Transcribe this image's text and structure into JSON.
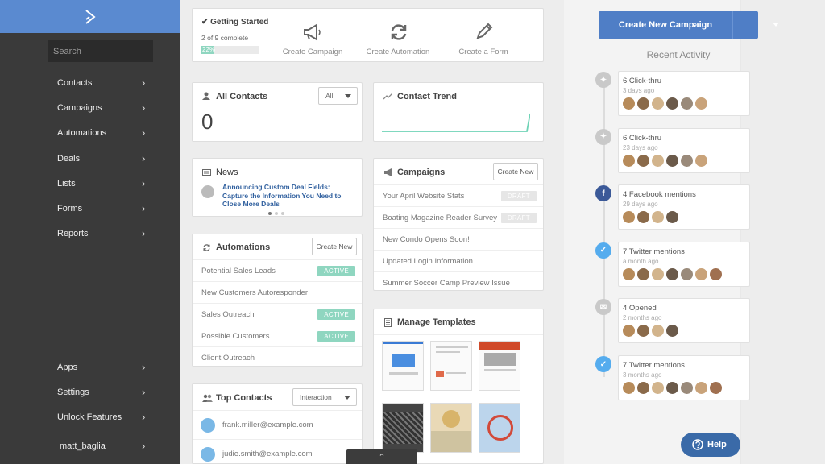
{
  "sidebar": {
    "search_placeholder": "Search",
    "items": [
      {
        "label": "Contacts"
      },
      {
        "label": "Campaigns"
      },
      {
        "label": "Automations"
      },
      {
        "label": "Deals"
      },
      {
        "label": "Lists"
      },
      {
        "label": "Forms"
      },
      {
        "label": "Reports"
      }
    ],
    "bottom_items": [
      {
        "label": "Apps"
      },
      {
        "label": "Settings"
      },
      {
        "label": "Unlock Features"
      }
    ],
    "user": "matt_baglia",
    "chevron": "›"
  },
  "getting_started": {
    "title": "✔ Getting Started",
    "progress_text": "2 of 9 complete",
    "progress_label": "22%",
    "progress": 0.22,
    "actions": [
      {
        "label": "Create Campaign",
        "icon": "megaphone-icon"
      },
      {
        "label": "Create Automation",
        "icon": "refresh-icon"
      },
      {
        "label": "Create a Form",
        "icon": "pencil-icon"
      }
    ]
  },
  "all_contacts": {
    "title": "All Contacts",
    "filter": "All",
    "count": "0"
  },
  "contact_trend": {
    "title": "Contact Trend"
  },
  "news": {
    "title": "News",
    "headline": "Announcing Custom Deal Fields: Capture the Information You Need to Close More Deals"
  },
  "campaigns": {
    "title": "Campaigns",
    "button": "Create New",
    "rows": [
      {
        "name": "Your April Website Stats",
        "badge": "DRAFT"
      },
      {
        "name": "Boating Magazine Reader Survey",
        "badge": "DRAFT"
      },
      {
        "name": "New Condo Opens Soon!",
        "badge": ""
      },
      {
        "name": "Updated Login Information",
        "badge": ""
      },
      {
        "name": "Summer Soccer Camp Preview Issue",
        "badge": ""
      }
    ]
  },
  "automations": {
    "title": "Automations",
    "button": "Create New",
    "rows": [
      {
        "name": "Potential Sales Leads",
        "badge": "ACTIVE"
      },
      {
        "name": "New Customers Autoresponder",
        "badge": ""
      },
      {
        "name": "Sales Outreach",
        "badge": "ACTIVE"
      },
      {
        "name": "Possible Customers",
        "badge": "ACTIVE"
      },
      {
        "name": "Client Outreach",
        "badge": ""
      }
    ]
  },
  "templates": {
    "title": "Manage Templates"
  },
  "top_contacts": {
    "title": "Top Contacts",
    "filter": "Interaction",
    "rows": [
      {
        "email": "frank.miller@example.com"
      },
      {
        "email": "judie.smith@example.com"
      }
    ]
  },
  "right_panel": {
    "cta": "Create New Campaign",
    "recent_title": "Recent Activity",
    "activities": [
      {
        "title": "6 Click-thru",
        "time": "3 days ago",
        "type": "click",
        "avatars": 6
      },
      {
        "title": "6 Click-thru",
        "time": "23 days ago",
        "type": "click",
        "avatars": 6
      },
      {
        "title": "4 Facebook mentions",
        "time": "29 days ago",
        "type": "facebook",
        "avatars": 4
      },
      {
        "title": "7 Twitter mentions",
        "time": "a month ago",
        "type": "twitter",
        "avatars": 7
      },
      {
        "title": "4 Opened",
        "time": "2 months ago",
        "type": "email",
        "avatars": 4
      },
      {
        "title": "7 Twitter mentions",
        "time": "3 months ago",
        "type": "twitter",
        "avatars": 7
      }
    ]
  },
  "help": {
    "label": "Help"
  },
  "colors": {
    "sidebar": "#3a3a3a",
    "accent": "#4f7ec6",
    "active": "#8fd6c0",
    "draft": "#e6e6e6",
    "trend": "#6fd3b6"
  }
}
